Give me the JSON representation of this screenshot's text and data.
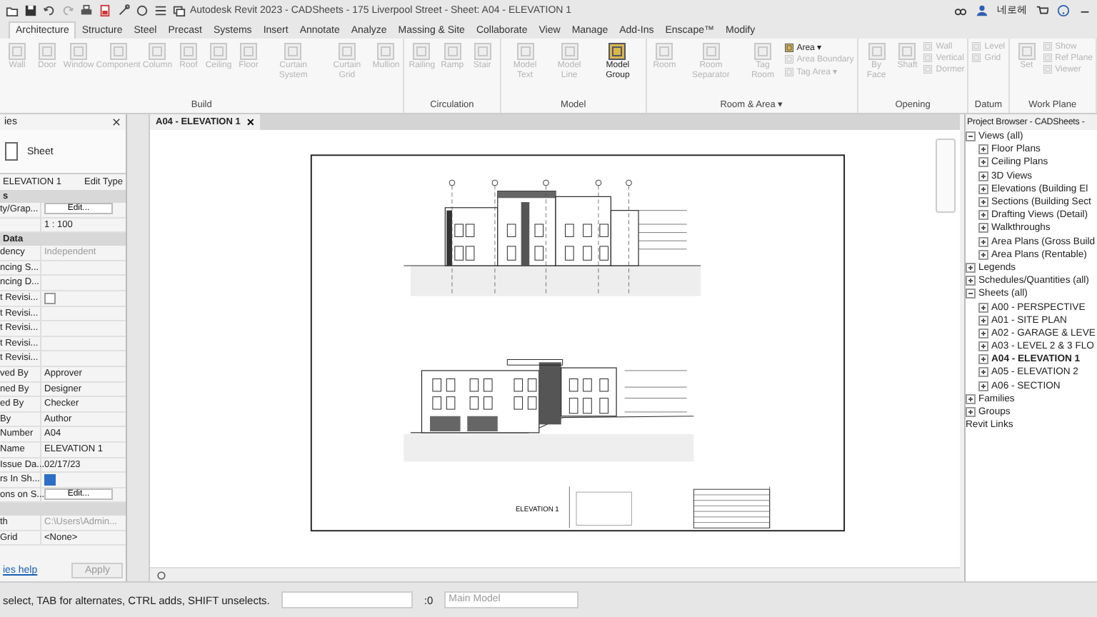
{
  "window": {
    "title": "Autodesk Revit 2023 - CADSheets - 175 Liverpool Street - Sheet: A04 - ELEVATION 1",
    "user": "네로헤"
  },
  "tabs": [
    {
      "label": "Architecture",
      "selected": true
    },
    {
      "label": "Structure",
      "selected": false
    },
    {
      "label": "Steel",
      "selected": false
    },
    {
      "label": "Precast",
      "selected": false
    },
    {
      "label": "Systems",
      "selected": false
    },
    {
      "label": "Insert",
      "selected": false
    },
    {
      "label": "Annotate",
      "selected": false
    },
    {
      "label": "Analyze",
      "selected": false
    },
    {
      "label": "Massing & Site",
      "selected": false
    },
    {
      "label": "Collaborate",
      "selected": false
    },
    {
      "label": "View",
      "selected": false
    },
    {
      "label": "Manage",
      "selected": false
    },
    {
      "label": "Add-Ins",
      "selected": false
    },
    {
      "label": "Enscape™",
      "selected": false
    },
    {
      "label": "Modify",
      "selected": false
    }
  ],
  "ribbon": [
    {
      "title": "Build",
      "tools": [
        {
          "label": "Wall",
          "kind": "large",
          "disabled": true
        },
        {
          "label": "Door",
          "kind": "large",
          "disabled": true
        },
        {
          "label": "Window",
          "kind": "large",
          "disabled": true
        },
        {
          "label": "Component",
          "kind": "large",
          "disabled": true
        },
        {
          "label": "Column",
          "kind": "large",
          "disabled": true
        },
        {
          "label": "Roof",
          "kind": "large",
          "disabled": true
        },
        {
          "label": "Ceiling",
          "kind": "large",
          "disabled": true
        },
        {
          "label": "Floor",
          "kind": "large",
          "disabled": true
        },
        {
          "label": "Curtain System",
          "kind": "large",
          "disabled": true
        },
        {
          "label": "Curtain Grid",
          "kind": "large",
          "disabled": true
        },
        {
          "label": "Mullion",
          "kind": "large",
          "disabled": true
        }
      ]
    },
    {
      "title": "Circulation",
      "tools": [
        {
          "label": "Railing",
          "kind": "large",
          "disabled": true
        },
        {
          "label": "Ramp",
          "kind": "large",
          "disabled": true
        },
        {
          "label": "Stair",
          "kind": "large",
          "disabled": true
        }
      ]
    },
    {
      "title": "Model",
      "tools": [
        {
          "label": "Model Text",
          "kind": "large",
          "disabled": true
        },
        {
          "label": "Model Line",
          "kind": "large",
          "disabled": true
        },
        {
          "label": "Model Group",
          "kind": "large",
          "disabled": false
        }
      ]
    },
    {
      "title": "Room & Area ▾",
      "tools": [
        {
          "label": "Room",
          "kind": "large",
          "disabled": true
        },
        {
          "label": "Room Separator",
          "kind": "large",
          "disabled": true
        },
        {
          "label": "Tag Room",
          "kind": "large",
          "disabled": true
        },
        {
          "label": "Area ▾",
          "kind": "small",
          "disabled": false
        },
        {
          "label": "Area Boundary",
          "kind": "small",
          "disabled": true
        },
        {
          "label": "Tag Area ▾",
          "kind": "small",
          "disabled": true
        }
      ]
    },
    {
      "title": "Opening",
      "tools": [
        {
          "label": "By Face",
          "kind": "large",
          "disabled": true
        },
        {
          "label": "Shaft",
          "kind": "large",
          "disabled": true
        },
        {
          "label": "Wall",
          "kind": "small",
          "disabled": true
        },
        {
          "label": "Vertical",
          "kind": "small",
          "disabled": true
        },
        {
          "label": "Dormer",
          "kind": "small",
          "disabled": true
        }
      ]
    },
    {
      "title": "Datum",
      "tools": [
        {
          "label": "Level",
          "kind": "small",
          "disabled": true
        },
        {
          "label": "Grid",
          "kind": "small",
          "disabled": true
        }
      ]
    },
    {
      "title": "Work Plane",
      "tools": [
        {
          "label": "Set",
          "kind": "large",
          "disabled": true
        },
        {
          "label": "Show",
          "kind": "small",
          "disabled": true
        },
        {
          "label": "Ref Plane",
          "kind": "small",
          "disabled": true
        },
        {
          "label": "Viewer",
          "kind": "small",
          "disabled": true
        }
      ]
    }
  ],
  "properties": {
    "title": "ies",
    "type": "Sheet",
    "instance": "ELEVATION 1",
    "edit_type": "Edit Type",
    "rows": [
      {
        "kind": "section",
        "label": "s"
      },
      {
        "kind": "button",
        "name": "ty/Grap...",
        "value": "Edit..."
      },
      {
        "kind": "text",
        "name": "",
        "value": "1 : 100"
      },
      {
        "kind": "section",
        "label": "Data"
      },
      {
        "kind": "muted",
        "name": "dency",
        "value": "Independent"
      },
      {
        "kind": "text",
        "name": "ncing S..."
      },
      {
        "kind": "text",
        "name": "ncing D..."
      },
      {
        "kind": "checkbox",
        "name": "t Revisi...",
        "checked": false
      },
      {
        "kind": "text",
        "name": "t Revisi..."
      },
      {
        "kind": "text",
        "name": "t Revisi..."
      },
      {
        "kind": "text",
        "name": "t Revisi..."
      },
      {
        "kind": "text",
        "name": "t Revisi..."
      },
      {
        "kind": "text",
        "name": "ved By",
        "value": "Approver"
      },
      {
        "kind": "text",
        "name": "ned By",
        "value": "Designer"
      },
      {
        "kind": "text",
        "name": "ed By",
        "value": "Checker"
      },
      {
        "kind": "text",
        "name": "By",
        "value": "Author"
      },
      {
        "kind": "text",
        "name": "Number",
        "value": "A04"
      },
      {
        "kind": "text",
        "name": "Name",
        "value": "ELEVATION 1"
      },
      {
        "kind": "text",
        "name": "Issue Da...",
        "value": "02/17/23"
      },
      {
        "kind": "checkbox",
        "name": "rs In Sh...",
        "checked": true
      },
      {
        "kind": "button",
        "name": "ons on S...",
        "value": "Edit..."
      },
      {
        "kind": "section",
        "label": ""
      },
      {
        "kind": "muted",
        "name": "th",
        "value": "C:\\Users\\Admin..."
      },
      {
        "kind": "text",
        "name": "Grid",
        "value": "<None>"
      }
    ],
    "help_link": "ies help",
    "apply": "Apply"
  },
  "view_tab": {
    "label": "A04 - ELEVATION 1",
    "close": "✕"
  },
  "sheet": {
    "view_title": "ELEVATION 1"
  },
  "project_browser": {
    "title": "Project Browser - CADSheets -",
    "tree": [
      {
        "label": "Views (all)",
        "expanded": true,
        "selected": false,
        "children": [
          {
            "label": "Floor Plans",
            "expanded": false,
            "selected": false
          },
          {
            "label": "Ceiling Plans",
            "expanded": false,
            "selected": false
          },
          {
            "label": "3D Views",
            "expanded": false,
            "selected": false
          },
          {
            "label": "Elevations (Building El",
            "expanded": false,
            "selected": false
          },
          {
            "label": "Sections (Building Sect",
            "expanded": false,
            "selected": false
          },
          {
            "label": "Drafting Views (Detail)",
            "expanded": false,
            "selected": false
          },
          {
            "label": "Walkthroughs",
            "expanded": false,
            "selected": false
          },
          {
            "label": "Area Plans (Gross Build",
            "expanded": false,
            "selected": false
          },
          {
            "label": "Area Plans (Rentable)",
            "expanded": false,
            "selected": false
          }
        ]
      },
      {
        "label": "Legends",
        "expanded": false,
        "selected": false
      },
      {
        "label": "Schedules/Quantities (all)",
        "expanded": false,
        "selected": false
      },
      {
        "label": "Sheets (all)",
        "expanded": true,
        "selected": false,
        "children": [
          {
            "label": "A00 - PERSPECTIVE",
            "expanded": false,
            "selected": false
          },
          {
            "label": "A01 - SITE PLAN",
            "expanded": false,
            "selected": false
          },
          {
            "label": "A02 - GARAGE & LEVE",
            "expanded": false,
            "selected": false
          },
          {
            "label": "A03 - LEVEL 2 & 3 FLO",
            "expanded": false,
            "selected": false
          },
          {
            "label": "A04 - ELEVATION 1",
            "expanded": false,
            "selected": true
          },
          {
            "label": "A05 - ELEVATION 2",
            "expanded": false,
            "selected": false
          },
          {
            "label": "A06 - SECTION",
            "expanded": false,
            "selected": false
          }
        ]
      },
      {
        "label": "Families",
        "expanded": false,
        "selected": false
      },
      {
        "label": "Groups",
        "expanded": false,
        "selected": false
      },
      {
        "label": "Revit Links",
        "selected": false
      }
    ]
  },
  "status_bar": {
    "message": "select, TAB for alternates, CTRL adds, SHIFT unselects.",
    "counter": ":0",
    "model": "Main Model"
  }
}
